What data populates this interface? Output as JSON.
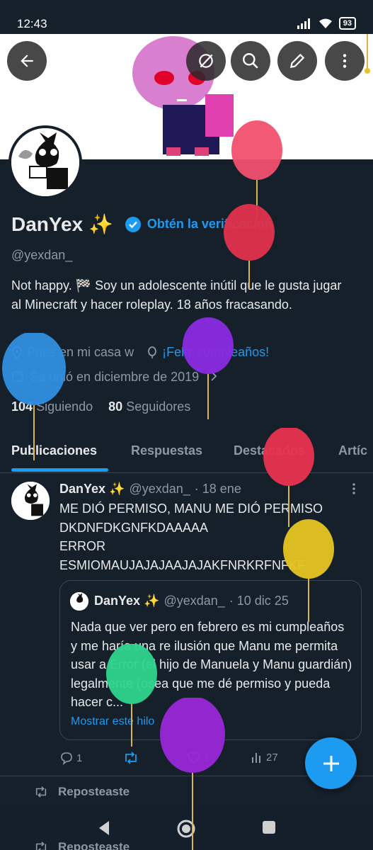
{
  "status": {
    "time": "12:43",
    "battery": "93"
  },
  "profile": {
    "name": "DanYex ✨",
    "verify_cta": "Obtén la verificación",
    "handle": "@yexdan_",
    "bio": "Not happy. 🏁 Soy un adolescente inútil que le gusta jugar al Minecraft y hacer roleplay. 18 años fracasando.",
    "location": "Pues en mi casa w",
    "birthday": "¡Feliz cumpleaños!",
    "joined": "Se unió en diciembre de 2019",
    "following_count": "104",
    "following_label": "Siguiendo",
    "followers_count": "80",
    "followers_label": "Seguidores"
  },
  "tabs": [
    "Publicaciones",
    "Respuestas",
    "Destacados",
    "Artíc"
  ],
  "tweet": {
    "name": "DanYex ✨",
    "handle": "@yexdan_",
    "date": "· 18 ene",
    "text": "ME DIÓ PERMISO, MANU ME DIÓ PERMISO\nDKDNFDKGNFKDAAAAA\nERROR\nESMIOMAUJAJAJAAJAJAKFNRKRFNFKF",
    "quote": {
      "name": "DanYex ✨",
      "handle": "@yexdan_",
      "date": "· 10 dic 25",
      "text": "Nada que ver pero en febrero es mi cumpleaños y me haría una re ilusión que Manu me permita usar a Error (el hijo de Manuela y Manu guardián) legalmente (osea que me dé permiso y pueda hacer c...",
      "show_more": "Mostrar este hilo"
    },
    "replies": "1",
    "likes": "1",
    "views": "27"
  },
  "reposted_label": "Reposteaste",
  "reposted_label_2": "Reposteaste",
  "colors": {
    "background": "#15202b",
    "accent": "#1d9bf0",
    "muted": "#8b98a5"
  }
}
